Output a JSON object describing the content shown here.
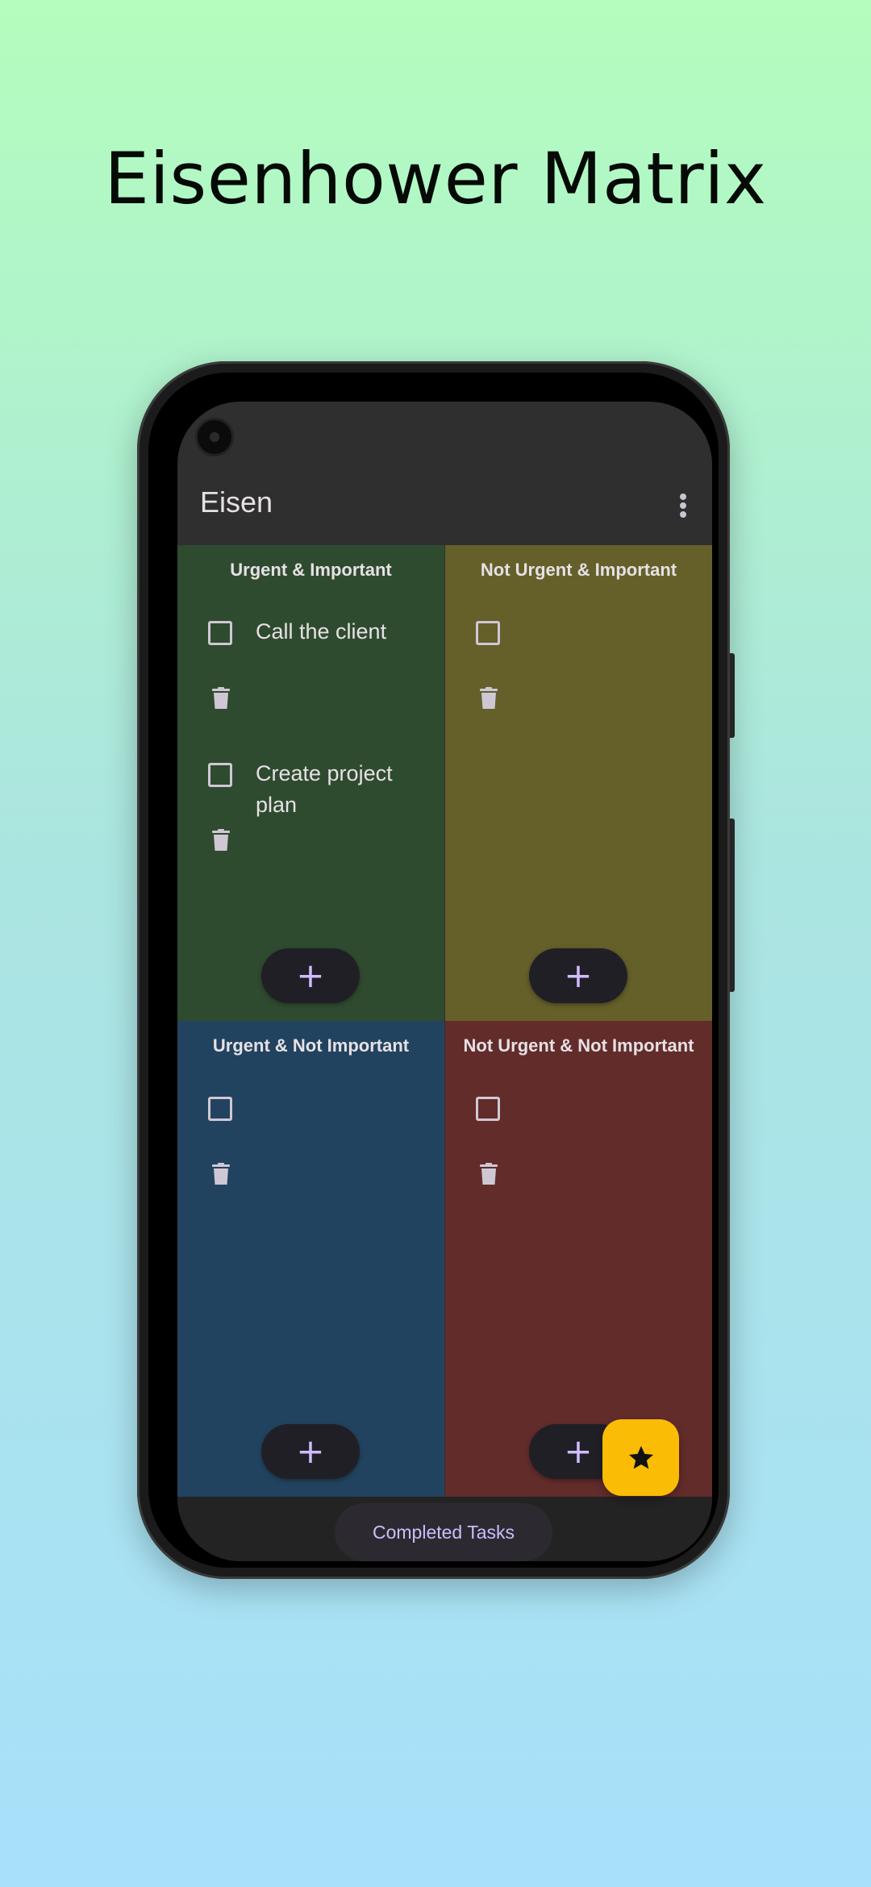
{
  "page": {
    "headline": "Eisenhower Matrix"
  },
  "app": {
    "title": "Eisen",
    "menu_icon": "more-vert-icon"
  },
  "quadrants": [
    {
      "title": "Urgent & Important",
      "color": "#2f4b2f",
      "tasks": [
        {
          "text": "Call the client",
          "checked": false
        },
        {
          "text": "Create project plan",
          "checked": false
        }
      ],
      "add_icon": "plus-icon"
    },
    {
      "title": "Not Urgent & Important",
      "color": "#655f2a",
      "tasks": [
        {
          "text": "",
          "checked": false
        }
      ],
      "add_icon": "plus-icon"
    },
    {
      "title": "Urgent & Not Important",
      "color": "#22435f",
      "tasks": [
        {
          "text": "",
          "checked": false
        }
      ],
      "add_icon": "plus-icon"
    },
    {
      "title": "Not Urgent & Not Important",
      "color": "#622c2a",
      "tasks": [
        {
          "text": "",
          "checked": false
        }
      ],
      "add_icon": "plus-icon"
    }
  ],
  "bottom": {
    "completed_label": "Completed Tasks"
  },
  "fab": {
    "icon": "star-icon",
    "color": "#fbbc05"
  },
  "colors": {
    "accent": "#d0bcff",
    "surface": "#2f2f2f"
  }
}
